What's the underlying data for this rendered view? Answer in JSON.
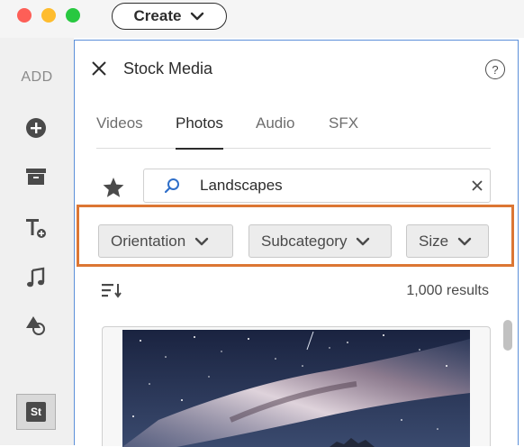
{
  "window": {
    "create_label": "Create"
  },
  "sidebar": {
    "add_label": "ADD",
    "items": [
      {
        "icon": "plus-circle-icon"
      },
      {
        "icon": "archive-icon"
      },
      {
        "icon": "text-add-icon"
      },
      {
        "icon": "music-note-icon"
      },
      {
        "icon": "shapes-icon"
      },
      {
        "icon": "stock-icon",
        "label": "St"
      }
    ]
  },
  "panel": {
    "title": "Stock Media",
    "help_label": "?",
    "tabs": [
      {
        "label": "Videos",
        "active": false
      },
      {
        "label": "Photos",
        "active": true
      },
      {
        "label": "Audio",
        "active": false
      },
      {
        "label": "SFX",
        "active": false
      }
    ],
    "search": {
      "value": "Landscapes"
    },
    "filters": [
      {
        "label": "Orientation"
      },
      {
        "label": "Subcategory"
      },
      {
        "label": "Size"
      }
    ],
    "results_label": "1,000 results"
  },
  "colors": {
    "highlight": "#dc7633",
    "panel_border": "#5b8fd9",
    "search_icon": "#2f6fc9"
  }
}
